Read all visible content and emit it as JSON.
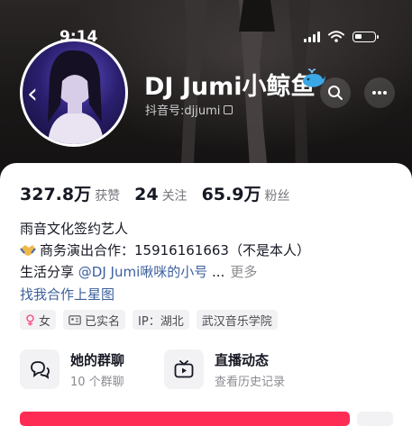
{
  "status_bar": {
    "time": "9:14"
  },
  "profile": {
    "name": "DJ Jumi小鲸鱼",
    "douyin_id": "抖音号:djjumi"
  },
  "stats": [
    {
      "value": "327.8万",
      "label": "获赞"
    },
    {
      "value": "24",
      "label": "关注"
    },
    {
      "value": "65.9万",
      "label": "粉丝"
    }
  ],
  "bio": {
    "line1": "雨音文化签约艺人",
    "line2": "商务演出合作：15916161663（不是本人）",
    "line3_prefix": "生活分享 ",
    "line3_link": "@DJ Jumi啾咪的小号",
    "line3_ellipsis": " ...",
    "more": "更多",
    "line4": "找我合作上星图"
  },
  "tags": [
    {
      "icon": "female-icon",
      "text": "女"
    },
    {
      "icon": "id-card-icon",
      "text": "已实名"
    },
    {
      "icon": "",
      "text": "IP：湖北"
    },
    {
      "icon": "",
      "text": "武汉音乐学院"
    }
  ],
  "features": [
    {
      "icon": "group-chat-icon",
      "title": "她的群聊",
      "subtitle": "10 个群聊"
    },
    {
      "icon": "live-tv-icon",
      "title": "直播动态",
      "subtitle": "查看历史记录"
    }
  ],
  "colors": {
    "primary_action": "#fe2c55",
    "link": "#3c5f9e",
    "header_bg": "#1a1717"
  }
}
